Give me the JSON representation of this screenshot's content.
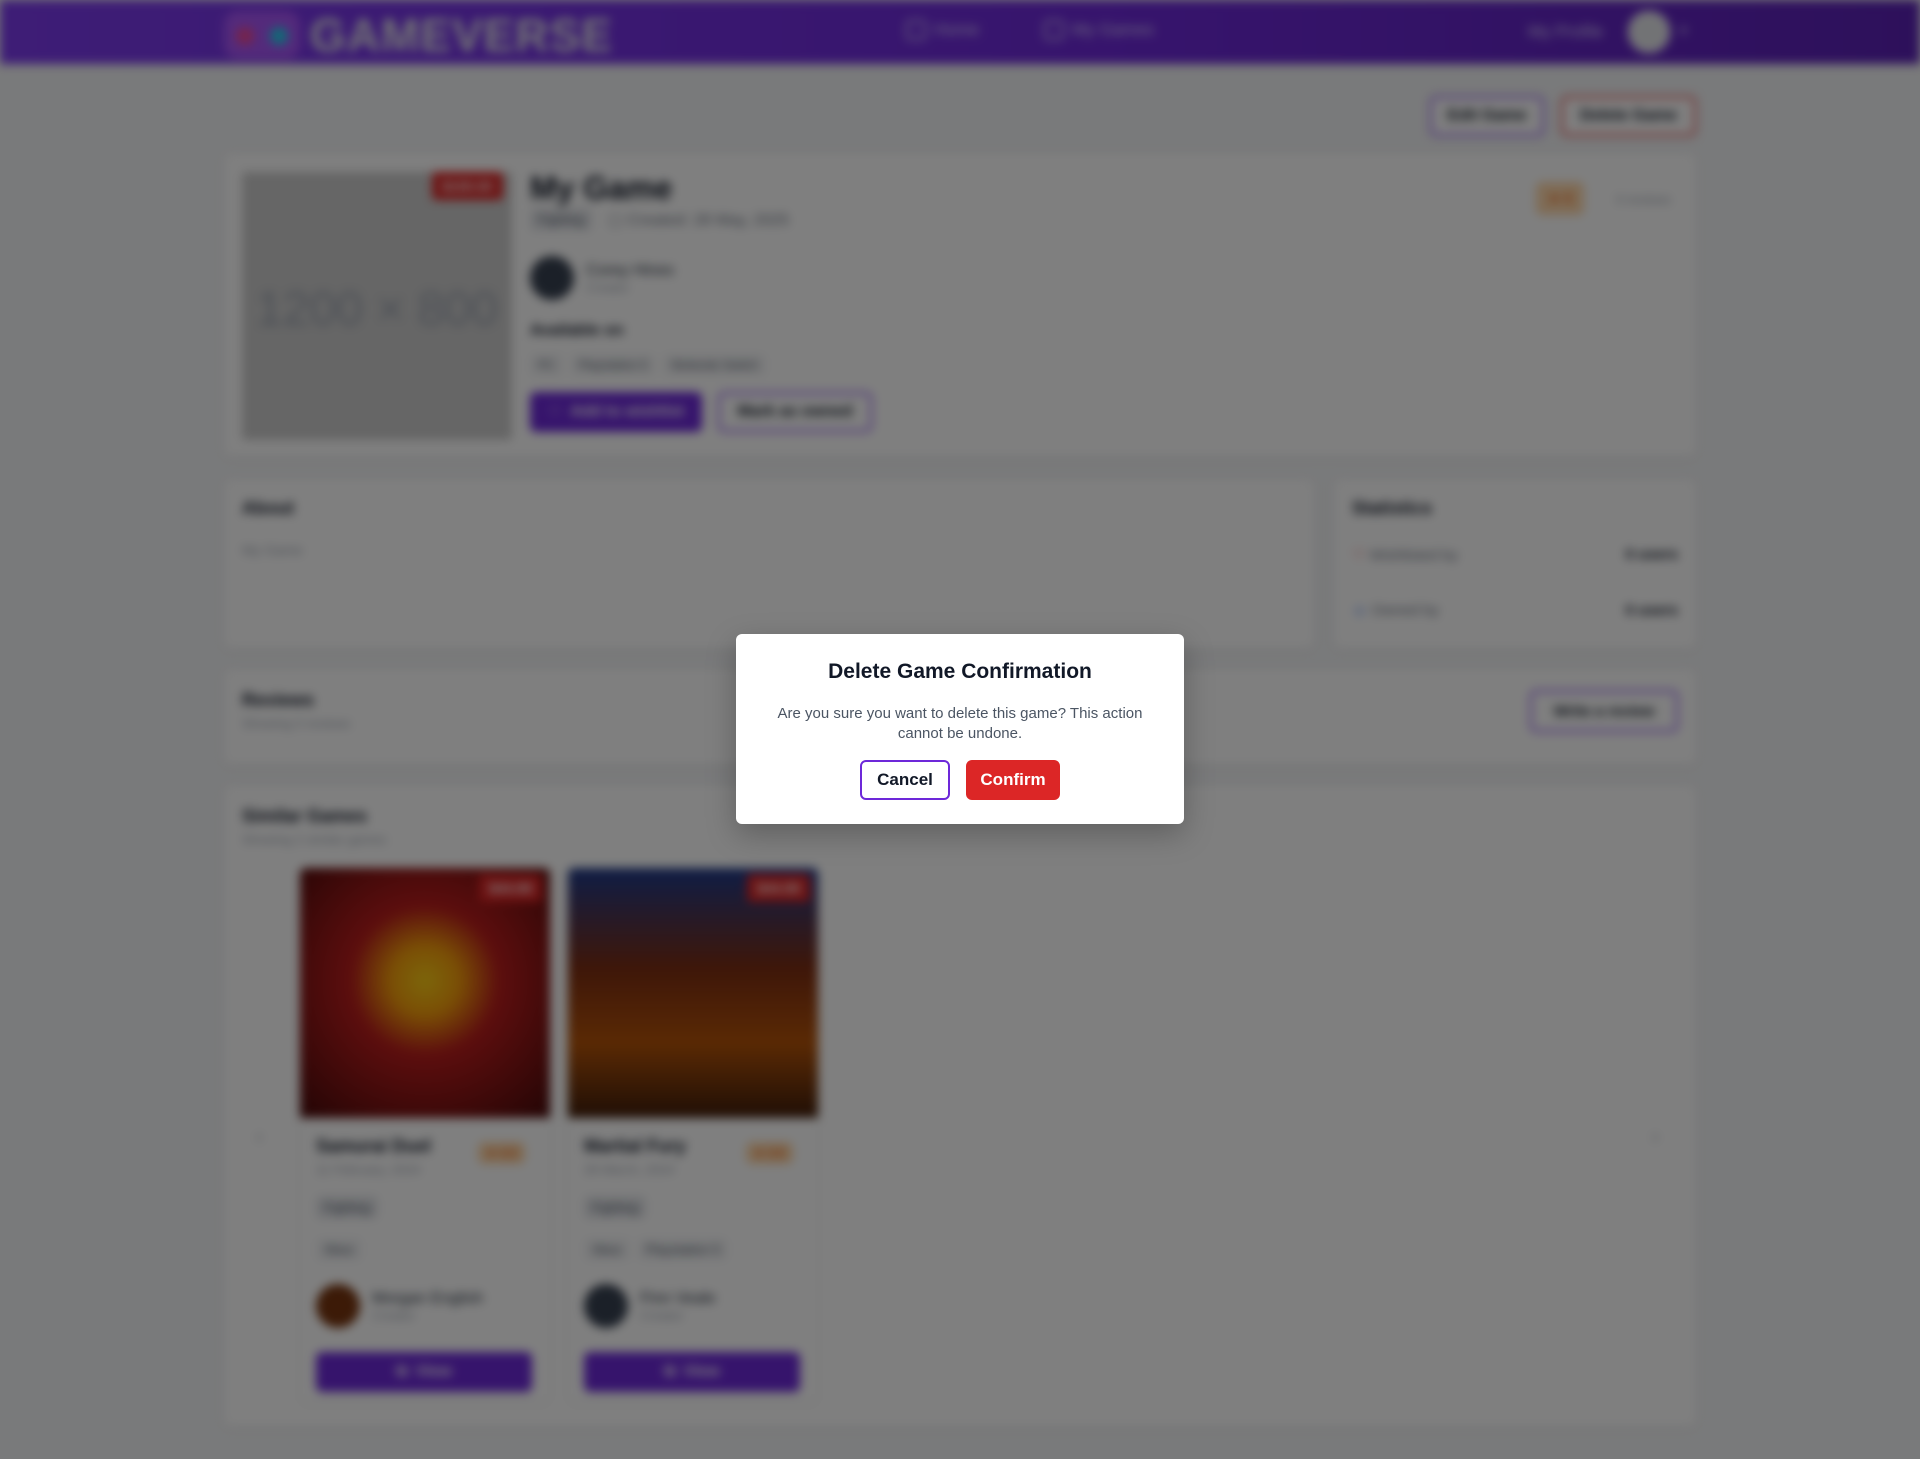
{
  "nav": {
    "brand": "GAMEVERSE",
    "links": [
      {
        "label": "Home",
        "icon": "home-icon"
      },
      {
        "label": "My Games",
        "icon": "trophy-icon"
      }
    ],
    "profile_label": "My Profile",
    "chevron": "▾"
  },
  "actions": {
    "edit_label": "Edit Game",
    "delete_label": "Delete Game"
  },
  "game": {
    "image_placeholder": "1200 × 800",
    "price": "$100.00",
    "title": "My Game",
    "genre": "Fighting",
    "created": "Created: 28 May, 2025",
    "creator_name": "Corey Hines",
    "creator_role": "Creator",
    "available_label": "Available on",
    "platforms": [
      "PC",
      "Playstation 5",
      "Nintendo Switch"
    ],
    "wishlist_label": "Add to wishlist",
    "owned_label": "Mark as owned",
    "rating": "0",
    "reviews_count": "0 reviews"
  },
  "about": {
    "heading": "About",
    "text": "My Game"
  },
  "statistics": {
    "heading": "Statistics",
    "wishlisted_label": "Wishlisted by",
    "wishlisted_value": "0 users",
    "owned_label": "Owned by",
    "owned_value": "0 users"
  },
  "reviews": {
    "heading": "Reviews",
    "subtitle": "Showing 0 reviews",
    "write_label": "Write a review"
  },
  "similar": {
    "heading": "Similar Games",
    "subtitle": "Showing 2 similar games",
    "prev": "‹",
    "next": "›",
    "games": [
      {
        "title": "Samurai Duel",
        "price": "$44.99",
        "rating": "4.3",
        "date": "11 February, 2024",
        "genre": "Fighting",
        "platforms": [
          "Xbox"
        ],
        "creator": "Morgan English",
        "role": "Creator",
        "view": "View"
      },
      {
        "title": "Martial Fury",
        "price": "$44.99",
        "rating": "3.5",
        "date": "28 March, 2024",
        "genre": "Fighting",
        "platforms": [
          "Xbox",
          "Playstation 5"
        ],
        "creator": "Finn Veale",
        "role": "Creator",
        "view": "View"
      }
    ]
  },
  "modal": {
    "title": "Delete Game Confirmation",
    "message": "Are you sure you want to delete this game? This action cannot be undone.",
    "cancel_label": "Cancel",
    "confirm_label": "Confirm"
  }
}
